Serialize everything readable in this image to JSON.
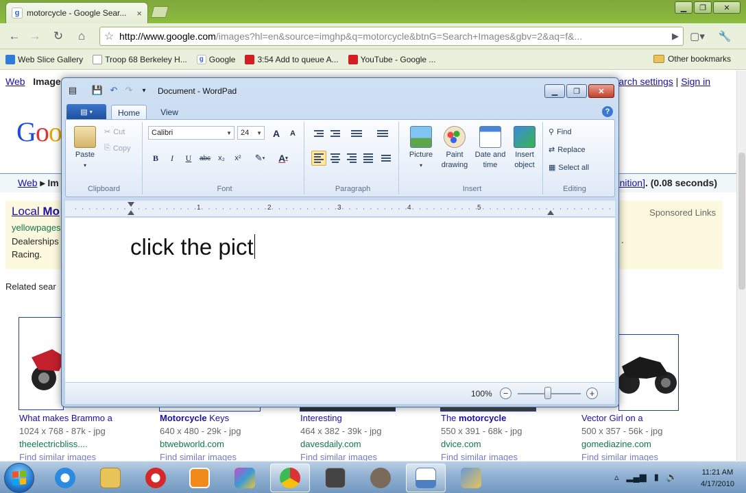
{
  "browser": {
    "tab_title": "motorcycle - Google Sear...",
    "tab_close": "×",
    "url_host": "http://www.google.com",
    "url_path": "/images?hl=en&source=imghp&q=motorcycle&btnG=Search+Images&gbv=2&aq=f&...",
    "bookmarks": [
      {
        "label": "Web Slice Gallery",
        "color": "#2f7bd6"
      },
      {
        "label": "Troop 68 Berkeley H...",
        "color": "#ffffff"
      },
      {
        "label": "Google",
        "color": "#4285f4"
      },
      {
        "label": "3:54 Add to queue A...",
        "color": "#d22020"
      },
      {
        "label": "YouTube - Google ...",
        "color": "#d22020"
      }
    ],
    "other_bookmarks": "Other bookmarks"
  },
  "google": {
    "top_web": "Web",
    "top_images": "Images",
    "search_settings": "Search settings",
    "sign_in": "Sign in",
    "logo": [
      "G",
      "o",
      "o"
    ],
    "results_left_web": "Web",
    "results_left_sep": "▸ Im",
    "results_right_link": "finition]",
    "results_right_text": ". (0.08 seconds)",
    "sponsored_title_a": "Local ",
    "sponsored_title_b": "Mo",
    "sponsored_url": "yellowpages",
    "sponsored_desc_1": "Dealerships",
    "sponsored_desc_2": "Racing.",
    "sponsored_label": "Sponsored Links",
    "sponsored_tail": ".",
    "related": "Related sear",
    "images": [
      {
        "title": "What makes Brammo a",
        "title_bold": "",
        "meta": "1024 x 768 - 87k - jpg",
        "site": "theelectricbliss....",
        "similar": "Find similar images"
      },
      {
        "title": " Keys",
        "title_bold": "Motorcycle",
        "meta": "640 x 480 - 29k - jpg",
        "site": "btwebworld.com",
        "similar": "Find similar images"
      },
      {
        "title": "Interesting",
        "title_bold": "",
        "meta": "464 x 382 - 39k - jpg",
        "site": "davesdaily.com",
        "similar": "Find similar images"
      },
      {
        "title": "The ",
        "title_bold": "motorcycle",
        "meta": "550 x 391 - 68k - jpg",
        "site": "dvice.com",
        "similar": "Find similar images"
      },
      {
        "title": "Vector Girl on a",
        "title_bold": "",
        "meta": "500 x 357 - 56k - jpg",
        "site": "gomediazine.com",
        "similar": "Find similar images"
      }
    ]
  },
  "wordpad": {
    "title": "Document - WordPad",
    "tabs": {
      "home": "Home",
      "view": "View"
    },
    "help": "?",
    "clipboard": {
      "paste": "Paste",
      "cut": "Cut",
      "copy": "Copy",
      "label": "Clipboard"
    },
    "font": {
      "family": "Calibri",
      "size": "24",
      "label": "Font",
      "bold": "B",
      "italic": "I",
      "underline": "U",
      "strike": "abc",
      "sub": "x₂",
      "sup": "x²",
      "grow": "A",
      "shrink": "A"
    },
    "paragraph": {
      "label": "Paragraph"
    },
    "insert": {
      "picture": "Picture",
      "paint": "Paint drawing",
      "datetime": "Date and time",
      "object": "Insert object",
      "label": "Insert"
    },
    "editing": {
      "find": "Find",
      "replace": "Replace",
      "select_all": "Select all",
      "label": "Editing"
    },
    "ruler_numbers": [
      "1",
      "2",
      "3",
      "4",
      "5"
    ],
    "document_text": "click the pict",
    "zoom": "100%",
    "zoom_out": "−",
    "zoom_in": "+"
  },
  "taskbar": {
    "time": "11:21 AM",
    "date": "4/17/2010",
    "apps": [
      {
        "name": "internet-explorer",
        "color": "#2a8be0"
      },
      {
        "name": "file-explorer",
        "color": "#e7c35a"
      },
      {
        "name": "itunes",
        "color": "#d4282a"
      },
      {
        "name": "media-player",
        "color": "#f08a1c"
      },
      {
        "name": "paint-app",
        "color": "#c84bc4"
      },
      {
        "name": "chrome",
        "color": "#3d9a32"
      },
      {
        "name": "media-tool",
        "color": "#444444"
      },
      {
        "name": "gimp",
        "color": "#7a6a5a"
      },
      {
        "name": "wordpad",
        "color": "#4d7fc1"
      },
      {
        "name": "paint-brush",
        "color": "#6a9ad6"
      }
    ]
  }
}
